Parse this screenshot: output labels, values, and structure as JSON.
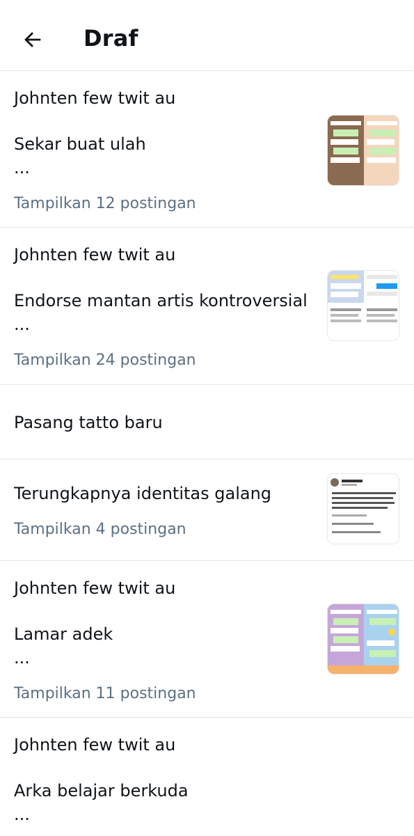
{
  "header": {
    "title": "Draf",
    "back_icon": "arrow-left-icon"
  },
  "drafts": [
    {
      "title": "Johnten few twit au",
      "subtitle": "Sekar buat ulah",
      "ellipsis": "...",
      "meta": "Tampilkan 12 postingan",
      "has_thumbnail": true
    },
    {
      "title": "Johnten few twit au",
      "subtitle": "Endorse mantan artis kontroversial",
      "ellipsis": "...",
      "meta": "Tampilkan 24 postingan",
      "has_thumbnail": true
    },
    {
      "title": "Pasang tatto baru"
    },
    {
      "title": "Terungkapnya identitas galang",
      "meta": "Tampilkan 4 postingan",
      "has_thumbnail": true
    },
    {
      "title": "Johnten few twit au",
      "subtitle": "Lamar adek",
      "ellipsis": "...",
      "meta": "Tampilkan 11 postingan",
      "has_thumbnail": true
    },
    {
      "title": "Johnten few twit au",
      "subtitle": "Arka belajar berkuda",
      "ellipsis": "..."
    }
  ],
  "colors": {
    "text": "#0f1419",
    "meta": "#5b7083",
    "divider": "#e1e4e6"
  }
}
